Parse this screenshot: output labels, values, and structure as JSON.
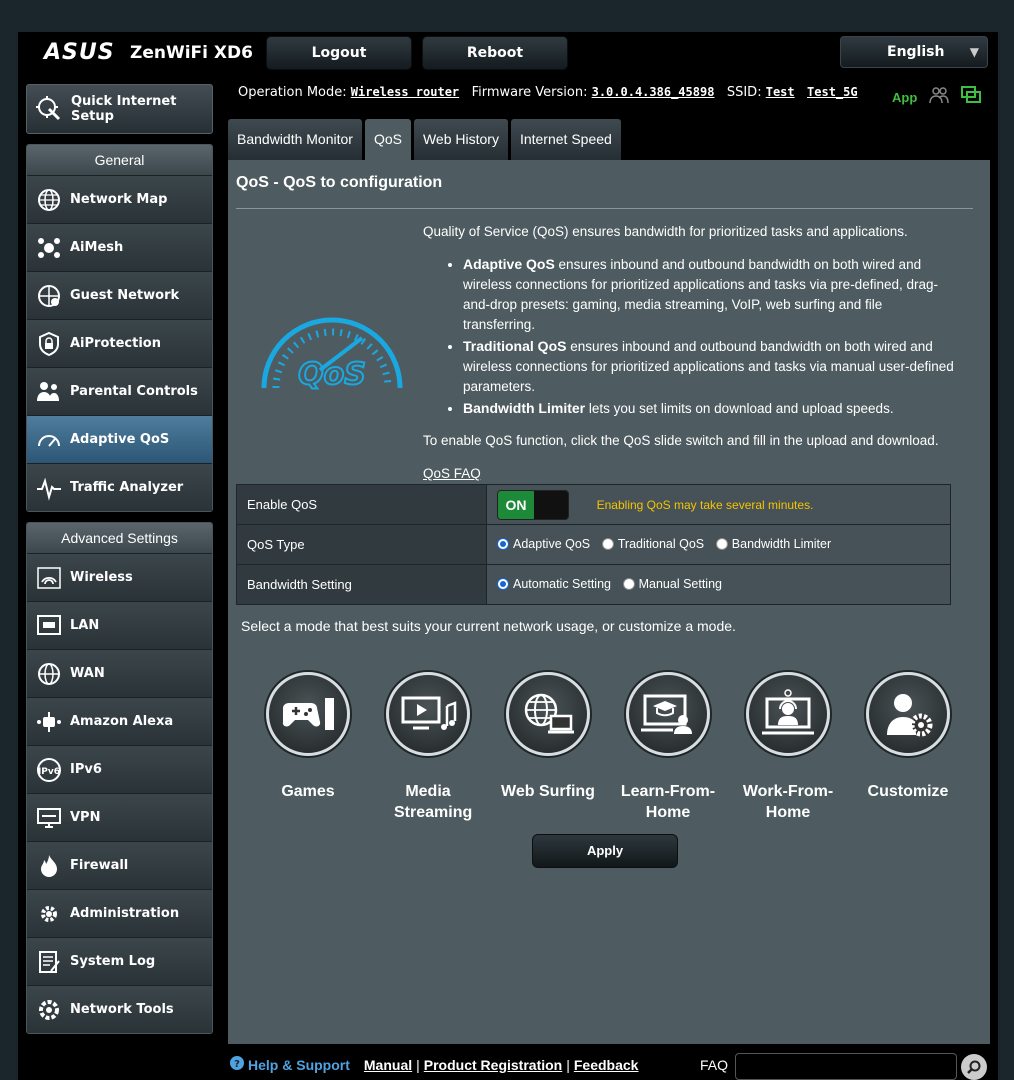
{
  "header": {
    "brand": "ASUS",
    "model": "ZenWiFi XD6",
    "logout_label": "Logout",
    "reboot_label": "Reboot",
    "language": "English"
  },
  "status": {
    "operation_mode_label": "Operation Mode:",
    "operation_mode": "Wireless router",
    "firmware_label": "Firmware Version:",
    "firmware": "3.0.0.4.386_45898",
    "ssid_label": "SSID:",
    "ssid_1": "Test",
    "ssid_2": "Test_5G",
    "app_label": "App"
  },
  "sidebar": {
    "quick_setup": "Quick Internet Setup",
    "general_title": "General",
    "general_items": [
      {
        "label": "Network Map",
        "icon": "globe-network-icon"
      },
      {
        "label": "AiMesh",
        "icon": "aimesh-icon"
      },
      {
        "label": "Guest Network",
        "icon": "guest-globe-icon"
      },
      {
        "label": "AiProtection",
        "icon": "lock-shield-icon"
      },
      {
        "label": "Parental Controls",
        "icon": "family-icon"
      },
      {
        "label": "Adaptive QoS",
        "icon": "speedometer-icon"
      },
      {
        "label": "Traffic Analyzer",
        "icon": "pulse-icon"
      }
    ],
    "advanced_title": "Advanced Settings",
    "advanced_items": [
      {
        "label": "Wireless",
        "icon": "wifi-icon"
      },
      {
        "label": "LAN",
        "icon": "lan-icon"
      },
      {
        "label": "WAN",
        "icon": "globe-icon"
      },
      {
        "label": "Amazon Alexa",
        "icon": "alexa-icon"
      },
      {
        "label": "IPv6",
        "icon": "ipv6-icon"
      },
      {
        "label": "VPN",
        "icon": "vpn-icon"
      },
      {
        "label": "Firewall",
        "icon": "fire-icon"
      },
      {
        "label": "Administration",
        "icon": "admin-gear-icon"
      },
      {
        "label": "System Log",
        "icon": "log-icon"
      },
      {
        "label": "Network Tools",
        "icon": "tools-gear-icon"
      }
    ]
  },
  "tabs": [
    "Bandwidth Monitor",
    "QoS",
    "Web History",
    "Internet Speed"
  ],
  "main": {
    "title": "QoS - QoS to configuration",
    "intro": "Quality of Service (QoS) ensures bandwidth for prioritized tasks and applications.",
    "bullets": [
      {
        "bold": "Adaptive QoS",
        "text": " ensures inbound and outbound bandwidth on both wired and wireless connections for prioritized applications and tasks via pre-defined, drag-and-drop presets: gaming, media streaming, VoIP, web surfing and file transferring."
      },
      {
        "bold": "Traditional QoS",
        "text": " ensures inbound and outbound bandwidth on both wired and wireless connections for prioritized applications and tasks via manual user-defined parameters."
      },
      {
        "bold": "Bandwidth Limiter",
        "text": " lets you set limits on download and upload speeds."
      }
    ],
    "enable_hint": "To enable QoS function, click the QoS slide switch and fill in the upload and download.",
    "faq_link": "QoS FAQ",
    "logo_text": "QoS",
    "settings": {
      "enable_label": "Enable QoS",
      "toggle_on": "ON",
      "warning": "Enabling QoS may take several minutes.",
      "type_label": "QoS Type",
      "type_options": [
        "Adaptive QoS",
        "Traditional QoS",
        "Bandwidth Limiter"
      ],
      "bandwidth_label": "Bandwidth Setting",
      "bandwidth_options": [
        "Automatic Setting",
        "Manual Setting"
      ]
    },
    "mode_hint": "Select a mode that best suits your current network usage, or customize a mode.",
    "modes": [
      {
        "label": "Games",
        "icon": "gamepad-icon"
      },
      {
        "label": "Media Streaming",
        "icon": "media-icon"
      },
      {
        "label": "Web Surfing",
        "icon": "web-icon"
      },
      {
        "label": "Learn-From-Home",
        "icon": "learn-icon"
      },
      {
        "label": "Work-From-Home",
        "icon": "work-icon"
      },
      {
        "label": "Customize",
        "icon": "customize-icon"
      }
    ],
    "apply_label": "Apply"
  },
  "footer": {
    "help": "Help & Support",
    "manual": "Manual",
    "registration": "Product Registration",
    "feedback": "Feedback",
    "faq_label": "FAQ"
  }
}
